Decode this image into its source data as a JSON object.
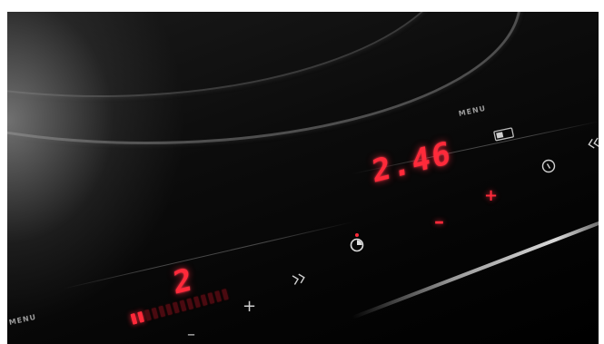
{
  "colors": {
    "display_red": "#ff2a3a",
    "glass": "#050505",
    "symbol_grey": "#d0d0d0"
  },
  "timer_zone": {
    "menu_label": "MENU",
    "time_display": "2.46",
    "plus_symbol": "+",
    "minus_symbol": "–",
    "icons": [
      "pause-icon",
      "power-icon",
      "chevron-left-icon",
      "timer-icon"
    ]
  },
  "cooking_zone": {
    "menu_label": "MENU",
    "power_level": "2",
    "minus_symbol": "–",
    "plus_symbol": "+",
    "boost_icon": "double-chevron-right-icon",
    "slider_segments": 14,
    "slider_level": 2
  }
}
